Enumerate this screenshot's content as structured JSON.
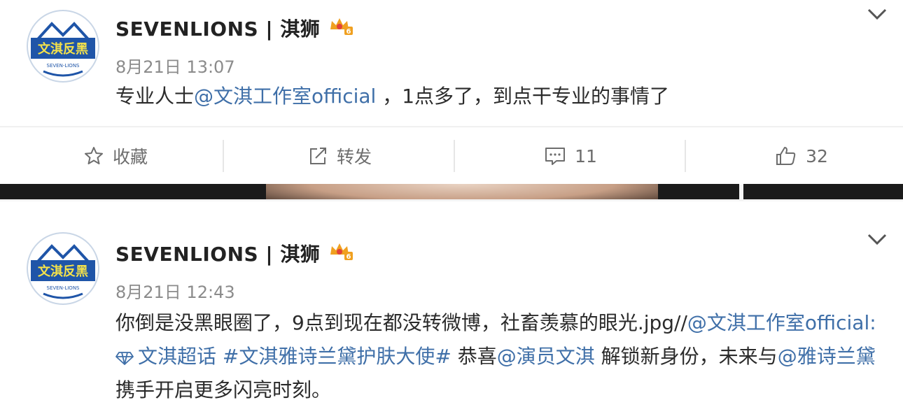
{
  "posts": [
    {
      "avatar_text": "文淇反黑",
      "avatar_subtext": "SEVEN-LIONS",
      "username": "SEVENLIONS | 淇狮",
      "timestamp": "8月21日 13:07",
      "content": {
        "prefix": "专业人士",
        "mention": "@文淇工作室official",
        "suffix": " ，1点多了，到点干专业的事情了"
      }
    },
    {
      "avatar_text": "文淇反黑",
      "avatar_subtext": "SEVEN-LIONS",
      "username": "SEVENLIONS | 淇狮",
      "timestamp": "8月21日 12:43",
      "content": {
        "part1": "你倒是没黑眼圈了，9点到现在都没转微博，社畜羡慕的眼光.jpg//",
        "mention1": "@文淇工作室official",
        "colon": ": ",
        "super_topic": "文淇超话",
        "hashtag": "#文淇雅诗兰黛护肤大使#",
        "part2": " 恭喜",
        "mention2": "@演员文淇",
        "part3": " 解锁新身份，未来与",
        "mention3": "@雅诗兰黛",
        "part4": " 携手开启更多闪亮时刻。"
      }
    }
  ],
  "actions": {
    "favorite": {
      "label": "收藏",
      "icon": "star-icon"
    },
    "repost": {
      "label": "转发",
      "icon": "share-icon"
    },
    "comment": {
      "label": "11",
      "icon": "comment-icon"
    },
    "like": {
      "label": "32",
      "icon": "thumbs-up-icon"
    }
  },
  "colors": {
    "link": "#3f6fa8",
    "badge": "#f0a020",
    "avatar_blue": "#1f55a8",
    "avatar_yellow": "#f5e24a"
  }
}
